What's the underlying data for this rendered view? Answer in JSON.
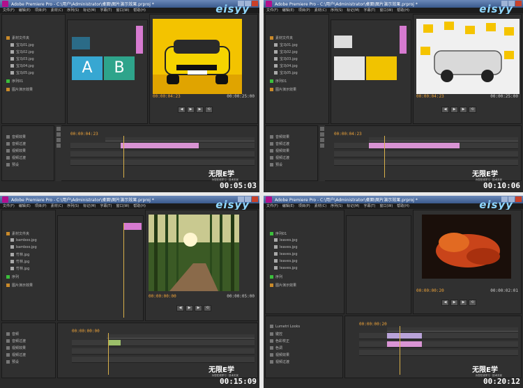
{
  "window_title": "Adobe Premiere Pro - C:\\用户\\Administrator\\桌面\\图片演示效果.prproj *",
  "brand": "eisyy",
  "menu": [
    "文件(F)",
    "编辑(E)",
    "项目(P)",
    "素材(C)",
    "序列(S)",
    "标记(M)",
    "字幕(T)",
    "窗口(W)",
    "帮助(H)"
  ],
  "logo_text": "无限E学",
  "logo_sub": "为您在线学习 · 技术无忧",
  "quadrants": [
    {
      "elapsed": "00:05:03",
      "program_tc_left": "00:00:04:23",
      "program_tc_right": "00:00:25:00",
      "timeline_tc": "00:00:04:23",
      "letters": [
        "A",
        "B"
      ],
      "project_items": [
        "素材文件夹",
        "宝马01.jpg",
        "宝马02.jpg",
        "宝马03.jpg",
        "宝马04.jpg",
        "宝马05.jpg",
        "序列01",
        "图片演示效果"
      ],
      "effects_items": [
        "音频效果",
        "音频过渡",
        "视频效果",
        "视频过渡",
        "预设"
      ],
      "accent": "#f5c400"
    },
    {
      "elapsed": "00:10:06",
      "program_tc_left": "00:00:04:23",
      "program_tc_right": "00:00:25:00",
      "timeline_tc": "00:00:04:23",
      "project_items": [
        "素材文件夹",
        "宝马01.jpg",
        "宝马02.jpg",
        "宝马03.jpg",
        "宝马04.jpg",
        "宝马05.jpg",
        "序列01",
        "图片演示效果"
      ],
      "effects_items": [
        "音频效果",
        "音频过渡",
        "视频效果",
        "视频过渡",
        "预设"
      ],
      "accent": "#f5c400"
    },
    {
      "elapsed": "00:15:09",
      "program_tc_left": "00:00:00:00",
      "program_tc_right": "00:00:05:00",
      "timeline_tc": "00:00:00:00",
      "project_items": [
        "素材文件夹",
        "bamboo.jpg",
        "bamboo.jpg",
        "竹林.jpg",
        "竹林.jpg",
        "竹林.jpg",
        "序列",
        "图片演示效果"
      ],
      "effects_items": [
        "音频",
        "音频过渡",
        "视频效果",
        "视频过渡",
        "预设"
      ],
      "accent": "#4a7a2a"
    },
    {
      "elapsed": "00:20:12",
      "program_tc_left": "00:00:00:20",
      "program_tc_right": "00:00:02:01",
      "timeline_tc": "00:00:00:20",
      "project_items": [
        "序列01",
        "leaves.jpg",
        "leaves.jpg",
        "leaves.jpg",
        "leaves.jpg",
        "leaves.jpg",
        "序列",
        "图片演示效果"
      ],
      "effects_items": [
        "Lumetri Looks",
        "键控",
        "色彩校正",
        "色调",
        "视频效果",
        "视频过渡"
      ],
      "accent": "#c04010"
    }
  ]
}
